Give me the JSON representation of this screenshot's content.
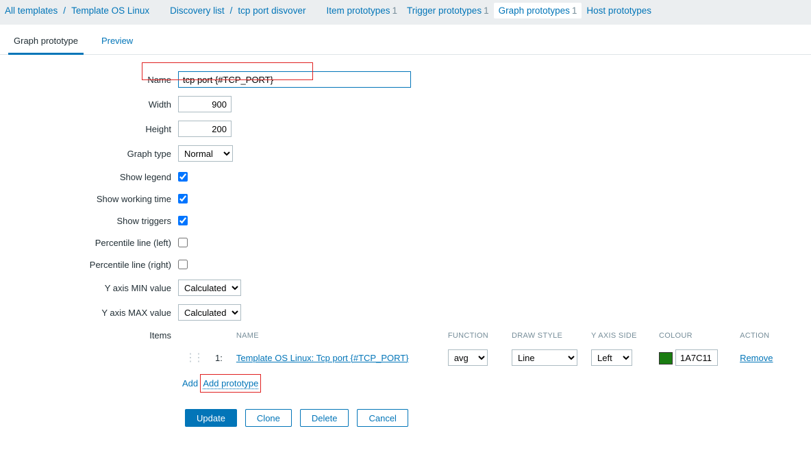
{
  "breadcrumb": {
    "all_templates": "All templates",
    "template": "Template OS Linux",
    "discovery_list": "Discovery list",
    "rule": "tcp port disvover",
    "tabs": {
      "item": {
        "label": "Item prototypes",
        "count": 1
      },
      "trigger": {
        "label": "Trigger prototypes",
        "count": 1
      },
      "graph": {
        "label": "Graph prototypes",
        "count": 1
      },
      "host": {
        "label": "Host prototypes",
        "count": ""
      }
    }
  },
  "subtabs": {
    "graph": "Graph prototype",
    "preview": "Preview"
  },
  "labels": {
    "name": "Name",
    "width": "Width",
    "height": "Height",
    "gtype": "Graph type",
    "show_legend": "Show legend",
    "show_work": "Show working time",
    "show_trig": "Show triggers",
    "perc_left": "Percentile line (left)",
    "perc_right": "Percentile line (right)",
    "ymin": "Y axis MIN value",
    "ymax": "Y axis MAX value",
    "items": "Items"
  },
  "values": {
    "name": "tcp port {#TCP_PORT}",
    "width": "900",
    "height": "200",
    "gtype": "Normal",
    "ymin": "Calculated",
    "ymax": "Calculated"
  },
  "items_table": {
    "headers": {
      "name": "NAME",
      "func": "FUNCTION",
      "style": "DRAW STYLE",
      "side": "Y AXIS SIDE",
      "colour": "COLOUR",
      "action": "ACTION"
    },
    "row": {
      "num": "1:",
      "item": "Template OS Linux: Tcp port {#TCP_PORT}",
      "func": "avg",
      "style": "Line",
      "side": "Left",
      "colour": "1A7C11",
      "swatch_hex": "#1A7C11",
      "action": "Remove"
    },
    "footer": {
      "add": "Add",
      "add_proto": "Add prototype"
    }
  },
  "buttons": {
    "update": "Update",
    "clone": "Clone",
    "delete": "Delete",
    "cancel": "Cancel"
  }
}
